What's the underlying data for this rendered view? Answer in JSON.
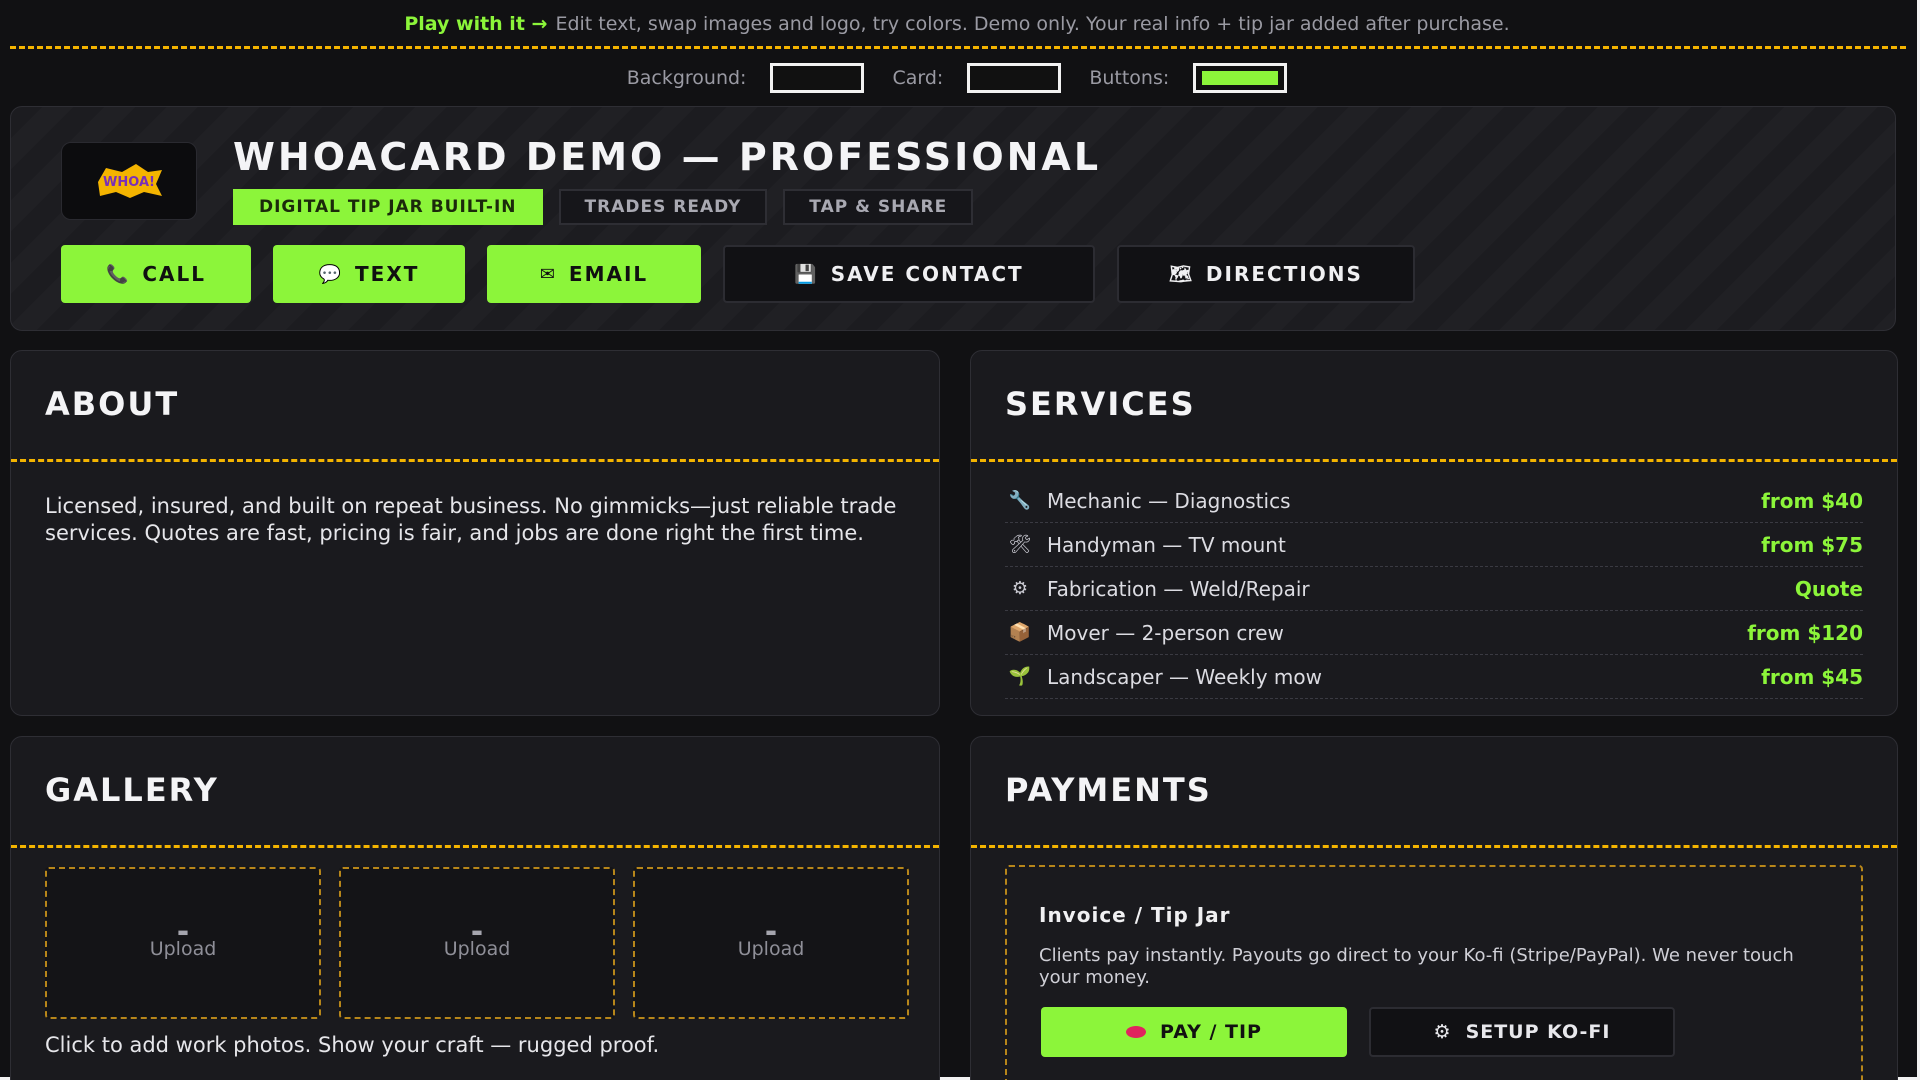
{
  "banner": {
    "lead": "Play with it →",
    "text": "Edit text, swap images and logo, try colors. Demo only. Your real info + tip jar added after purchase."
  },
  "colors": {
    "background_label": "Background:",
    "card_label": "Card:",
    "buttons_label": "Buttons:",
    "accent": "#8cf53a",
    "dash": "#f4b400"
  },
  "hero": {
    "logo_text": "WHOA!",
    "title": "WHOACARD DEMO — PROFESSIONAL",
    "tags": [
      "DIGITAL TIP JAR BUILT-IN",
      "TRADES READY",
      "TAP & SHARE"
    ],
    "actions": [
      {
        "icon": "📞",
        "label": "CALL"
      },
      {
        "icon": "💬",
        "label": "TEXT"
      },
      {
        "icon": "✉",
        "label": "EMAIL"
      },
      {
        "icon": "💾",
        "label": "SAVE CONTACT"
      },
      {
        "icon": "🗺",
        "label": "DIRECTIONS"
      }
    ]
  },
  "about": {
    "title": "ABOUT",
    "text": "Licensed, insured, and built on repeat business. No gimmicks—just reliable trade services. Quotes are fast, pricing is fair, and jobs are done right the first time."
  },
  "services": {
    "title": "SERVICES",
    "items": [
      {
        "icon": "🔧",
        "name": "Mechanic — Diagnostics",
        "price": "from $40"
      },
      {
        "icon": "🛠",
        "name": "Handyman — TV mount",
        "price": "from $75"
      },
      {
        "icon": "⚙",
        "name": "Fabrication — Weld/Repair",
        "price": "Quote"
      },
      {
        "icon": "📦",
        "name": "Mover — 2-person crew",
        "price": "from $120"
      },
      {
        "icon": "🌱",
        "name": "Landscaper — Weekly mow",
        "price": "from $45"
      }
    ]
  },
  "gallery": {
    "title": "GALLERY",
    "tiles": [
      "Upload",
      "Upload",
      "Upload"
    ],
    "caption": "Click to add work photos. Show your craft — rugged proof."
  },
  "payments": {
    "title": "PAYMENTS",
    "box_title": "Invoice / Tip Jar",
    "box_text": "Clients pay instantly. Payouts go direct to your Ko-fi (Stripe/PayPal). We never touch your money.",
    "pay_label": "PAY / TIP",
    "setup_label": "SETUP KO-FI"
  }
}
